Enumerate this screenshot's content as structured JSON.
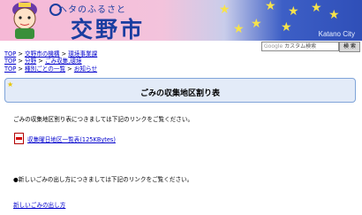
{
  "header": {
    "logo_sub": "ヘタのふるさと",
    "logo_main": "交野市",
    "city_label": "Katano City"
  },
  "search": {
    "placeholder": "カスタム検索",
    "button_label": "検 索",
    "google_label": "Google"
  },
  "breadcrumbs": [
    [
      "TOP",
      ">",
      "交野市の機構",
      ">",
      "環境事業課"
    ],
    [
      "TOP",
      ">",
      "分野",
      ">",
      "ごみ収集,環境"
    ],
    [
      "TOP",
      ">",
      "種別ごとの一覧",
      ">",
      "お知らせ"
    ]
  ],
  "page": {
    "title": "ごみの収集地区割り表",
    "intro": "ごみの収集地区割り表につきましては下記のリンクをご覧ください。",
    "pdf_link": "収集曜日地区一覧表(125KBytes)",
    "new_method_text": "●新しいごみの出し方につきましては下記のリンクをご覧ください。",
    "new_method_link": "新しいごみの出し方"
  },
  "colors": {
    "link": "#0000cc",
    "title_box_bg": "#e3ebf8",
    "brand": "#1a3da0"
  }
}
